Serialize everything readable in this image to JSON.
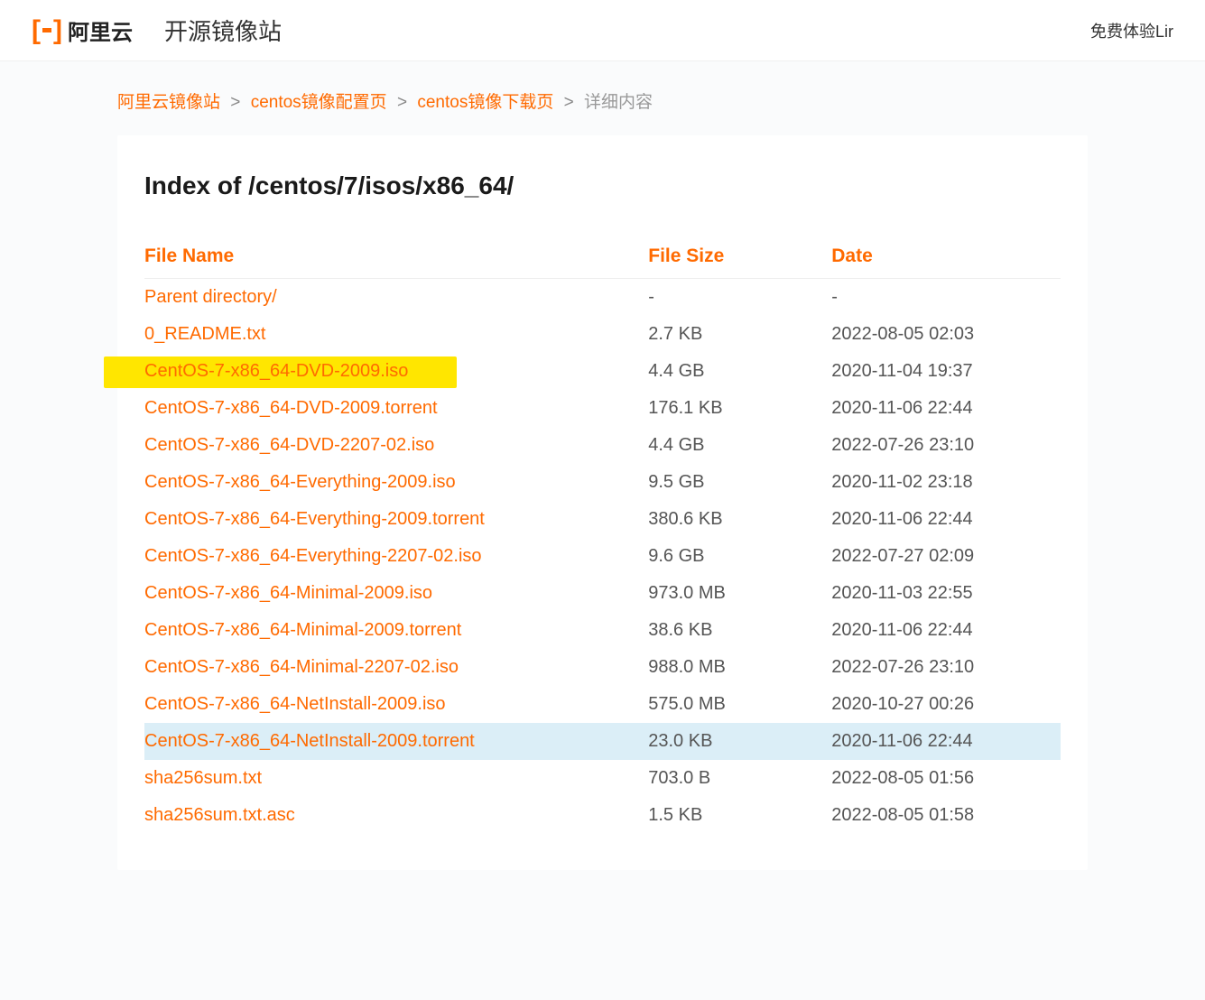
{
  "header": {
    "logo_cn": "阿里云",
    "site_title": "开源镜像站",
    "right_text": "免费体验Lir"
  },
  "breadcrumb": {
    "items": [
      {
        "label": "阿里云镜像站",
        "link": true
      },
      {
        "label": "centos镜像配置页",
        "link": true
      },
      {
        "label": "centos镜像下载页",
        "link": true
      },
      {
        "label": "详细内容",
        "link": false
      }
    ],
    "sep": ">"
  },
  "page_title": "Index of /centos/7/isos/x86_64/",
  "table": {
    "headers": {
      "name": "File Name",
      "size": "File Size",
      "date": "Date"
    },
    "rows": [
      {
        "name": "Parent directory/",
        "size": "-",
        "date": "-",
        "highlight": ""
      },
      {
        "name": "0_README.txt",
        "size": "2.7 KB",
        "date": "2022-08-05 02:03",
        "highlight": ""
      },
      {
        "name": "CentOS-7-x86_64-DVD-2009.iso",
        "size": "4.4 GB",
        "date": "2020-11-04 19:37",
        "highlight": "yellow"
      },
      {
        "name": "CentOS-7-x86_64-DVD-2009.torrent",
        "size": "176.1 KB",
        "date": "2020-11-06 22:44",
        "highlight": ""
      },
      {
        "name": "CentOS-7-x86_64-DVD-2207-02.iso",
        "size": "4.4 GB",
        "date": "2022-07-26 23:10",
        "highlight": ""
      },
      {
        "name": "CentOS-7-x86_64-Everything-2009.iso",
        "size": "9.5 GB",
        "date": "2020-11-02 23:18",
        "highlight": ""
      },
      {
        "name": "CentOS-7-x86_64-Everything-2009.torrent",
        "size": "380.6 KB",
        "date": "2020-11-06 22:44",
        "highlight": ""
      },
      {
        "name": "CentOS-7-x86_64-Everything-2207-02.iso",
        "size": "9.6 GB",
        "date": "2022-07-27 02:09",
        "highlight": ""
      },
      {
        "name": "CentOS-7-x86_64-Minimal-2009.iso",
        "size": "973.0 MB",
        "date": "2020-11-03 22:55",
        "highlight": ""
      },
      {
        "name": "CentOS-7-x86_64-Minimal-2009.torrent",
        "size": "38.6 KB",
        "date": "2020-11-06 22:44",
        "highlight": ""
      },
      {
        "name": "CentOS-7-x86_64-Minimal-2207-02.iso",
        "size": "988.0 MB",
        "date": "2022-07-26 23:10",
        "highlight": ""
      },
      {
        "name": "CentOS-7-x86_64-NetInstall-2009.iso",
        "size": "575.0 MB",
        "date": "2020-10-27 00:26",
        "highlight": ""
      },
      {
        "name": "CentOS-7-x86_64-NetInstall-2009.torrent",
        "size": "23.0 KB",
        "date": "2020-11-06 22:44",
        "highlight": "hover"
      },
      {
        "name": "sha256sum.txt",
        "size": "703.0 B",
        "date": "2022-08-05 01:56",
        "highlight": ""
      },
      {
        "name": "sha256sum.txt.asc",
        "size": "1.5 KB",
        "date": "2022-08-05 01:58",
        "highlight": ""
      }
    ]
  }
}
